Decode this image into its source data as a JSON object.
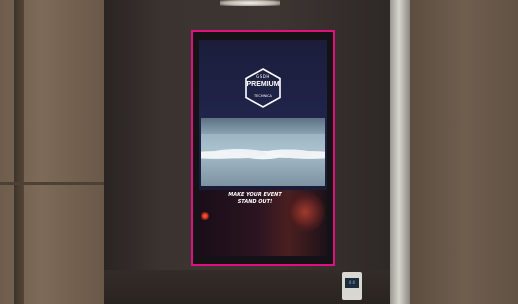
{
  "scene": {
    "description_name": "Lobby wall with vertical digital signage display"
  },
  "display": {
    "frame_color": "#e0107f",
    "logo": {
      "brand_small": "GSDH",
      "brand_main": "PREMIUM",
      "brand_sub": "TECHNICA"
    },
    "tagline_line1": "MAKE YOUR EVENT",
    "tagline_line2": "STAND OUT!"
  },
  "wall_panel": {
    "lcd_text": "0:0"
  }
}
